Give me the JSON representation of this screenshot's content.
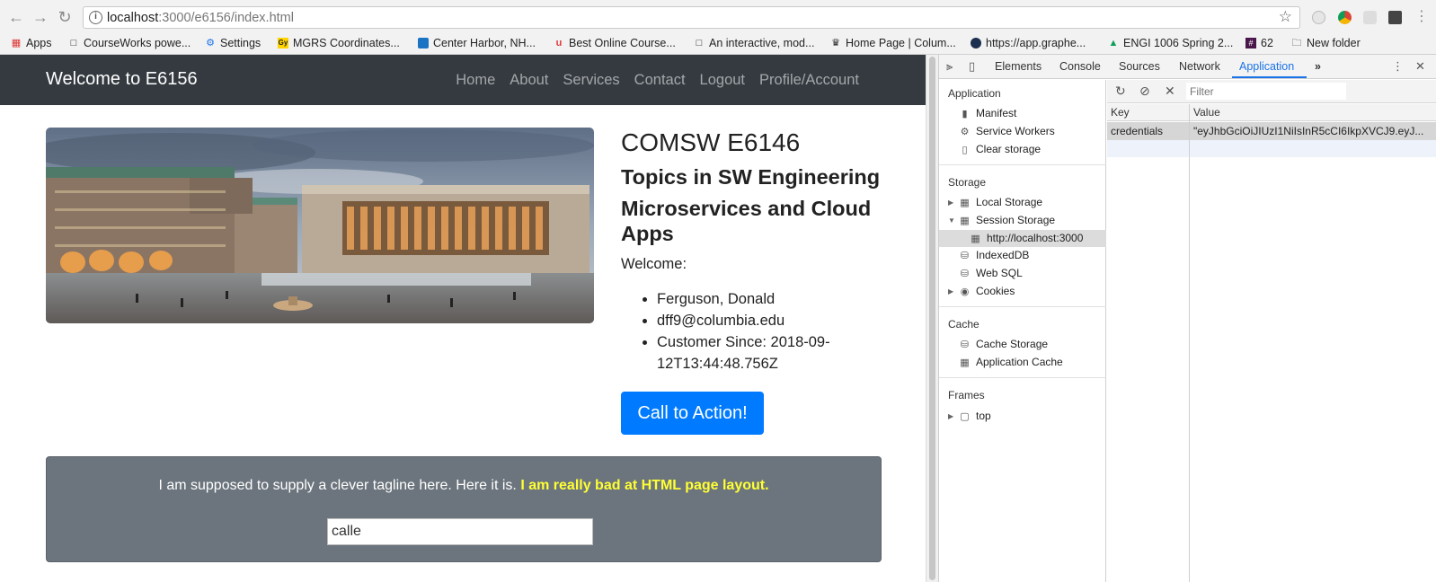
{
  "browser": {
    "url_host": "localhost",
    "url_path": ":3000/e6156/index.html",
    "bookmarks": [
      {
        "label": "Apps",
        "icon": "apps-grid-icon"
      },
      {
        "label": "CourseWorks powe...",
        "icon": "page-icon"
      },
      {
        "label": "Settings",
        "icon": "gear-icon"
      },
      {
        "label": "MGRS Coordinates...",
        "icon": "gy-logo-icon"
      },
      {
        "label": "Center Harbor, NH...",
        "icon": "site-icon"
      },
      {
        "label": "Best Online Course...",
        "icon": "udemy-icon"
      },
      {
        "label": "An interactive, mod...",
        "icon": "page-icon"
      },
      {
        "label": "Home Page | Colum...",
        "icon": "crown-icon"
      },
      {
        "label": "https://app.graphe...",
        "icon": "circle-logo-icon"
      },
      {
        "label": "ENGI 1006 Spring 2...",
        "icon": "drive-icon"
      },
      {
        "label": "62",
        "icon": "slack-icon"
      },
      {
        "label": "New folder",
        "icon": "folder-icon"
      }
    ]
  },
  "navbar": {
    "brand": "Welcome to E6156",
    "links": [
      "Home",
      "About",
      "Services",
      "Contact",
      "Logout",
      "Profile/Account"
    ]
  },
  "course": {
    "code": "COMSW E6146",
    "topic": "Topics in SW Engineering",
    "subtitle": "Microservices and Cloud Apps",
    "welcome": "Welcome:",
    "user": {
      "name": "Ferguson, Donald",
      "email": "dff9@columbia.edu",
      "customer_since": "Customer Since: 2018-09-12T13:44:48.756Z"
    },
    "cta": "Call to Action!"
  },
  "jumbotron": {
    "tagline": "I am supposed to supply a clever tagline here. Here it is.",
    "tagline_highlight": "I am really bad at HTML page layout.",
    "input_value": "calle"
  },
  "devtools": {
    "tabs": [
      "Elements",
      "Console",
      "Sources",
      "Network",
      "Application"
    ],
    "active_tab": "Application",
    "more": "»",
    "sidebar": {
      "application_head": "Application",
      "application_items": [
        "Manifest",
        "Service Workers",
        "Clear storage"
      ],
      "storage_head": "Storage",
      "storage_items": [
        "Local Storage",
        "Session Storage",
        "http://localhost:3000",
        "IndexedDB",
        "Web SQL",
        "Cookies"
      ],
      "cache_head": "Cache",
      "cache_items": [
        "Cache Storage",
        "Application Cache"
      ],
      "frames_head": "Frames",
      "frames_items": [
        "top"
      ]
    },
    "filter_placeholder": "Filter",
    "columns": [
      "Key",
      "Value"
    ],
    "rows": [
      {
        "key": "credentials",
        "value": "\"eyJhbGciOiJIUzI1NiIsInR5cCI6IkpXVCJ9.eyJ..."
      }
    ],
    "accent": "#1a73e8"
  },
  "colors": {
    "navbar_bg": "#343a40",
    "cta_bg": "#007bff",
    "jumbotron_bg": "#6c757d",
    "highlight": "#ffff33"
  }
}
